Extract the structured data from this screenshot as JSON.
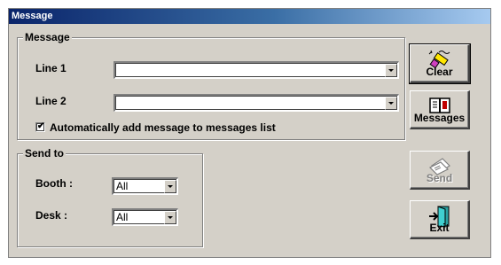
{
  "window": {
    "title": "Message"
  },
  "message_group": {
    "legend": "Message",
    "line1": {
      "label": "Line 1",
      "value": ""
    },
    "line2": {
      "label": "Line 2",
      "value": ""
    },
    "auto_add": {
      "label": "Automatically add message to messages list",
      "checked": true,
      "checkmark": "✔"
    }
  },
  "sendto_group": {
    "legend": "Send to",
    "booth": {
      "label": "Booth :",
      "value": "All"
    },
    "desk": {
      "label": "Desk :",
      "value": "All"
    }
  },
  "buttons": {
    "clear": {
      "label": "Clear",
      "icon": "eraser-icon",
      "enabled": true
    },
    "messages": {
      "label": "Messages",
      "icon": "book-icon",
      "enabled": true
    },
    "send": {
      "label": "Send",
      "icon": "envelope-icon",
      "enabled": false
    },
    "exit": {
      "label": "Exit",
      "icon": "exit-door-icon",
      "enabled": true
    }
  },
  "colors": {
    "titlebar_start": "#0a246a",
    "titlebar_end": "#a6caf0",
    "face": "#d4d0c8"
  }
}
